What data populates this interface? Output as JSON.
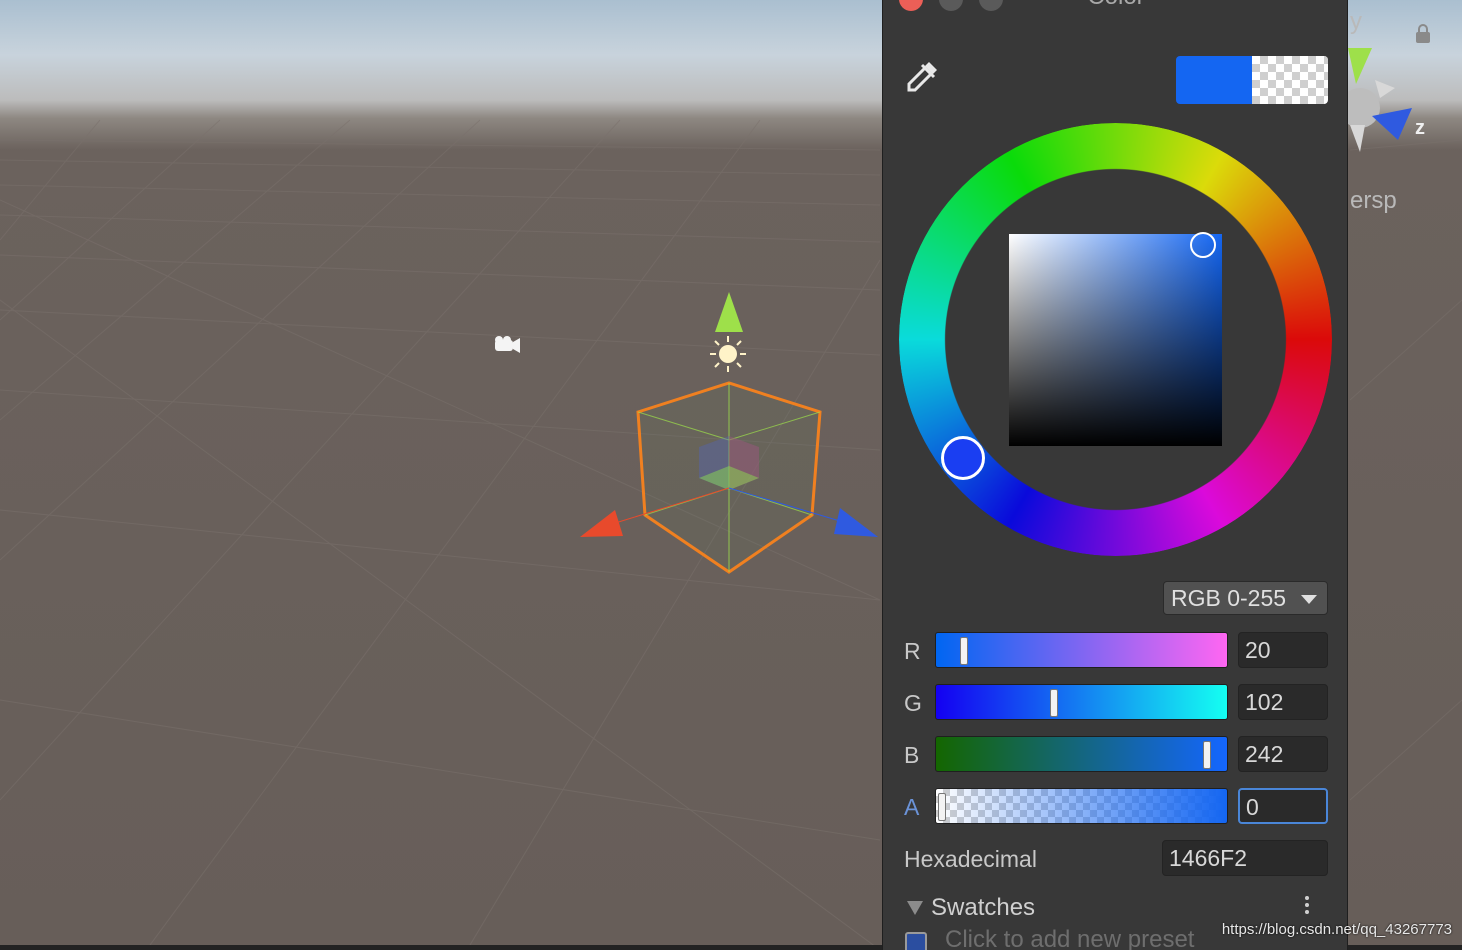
{
  "scene": {
    "partial_label_top": "y",
    "axis_label_z": "z",
    "projection_partial": "ersp",
    "colors": {
      "selection_outline": "#f08020",
      "axis_x": "#e84a2c",
      "axis_y": "#9ee04a",
      "axis_z": "#2f5ae0"
    },
    "icons": [
      "camera-icon",
      "light-icon",
      "lock-icon"
    ]
  },
  "color_window": {
    "title": "Color",
    "current_color_hex": "#1466F2",
    "mode_dropdown": "RGB 0-255",
    "channels": [
      {
        "label": "R",
        "value": "20",
        "fraction": 0.078
      },
      {
        "label": "G",
        "value": "102",
        "fraction": 0.4
      },
      {
        "label": "B",
        "value": "242",
        "fraction": 0.949
      },
      {
        "label": "A",
        "value": "0",
        "fraction": 0.0
      }
    ],
    "hex_label": "Hexadecimal",
    "hex_value": "1466F2",
    "swatches_label": "Swatches",
    "add_preset_text": "Click to add new preset"
  },
  "watermark": "https://blog.csdn.net/qq_43267773"
}
